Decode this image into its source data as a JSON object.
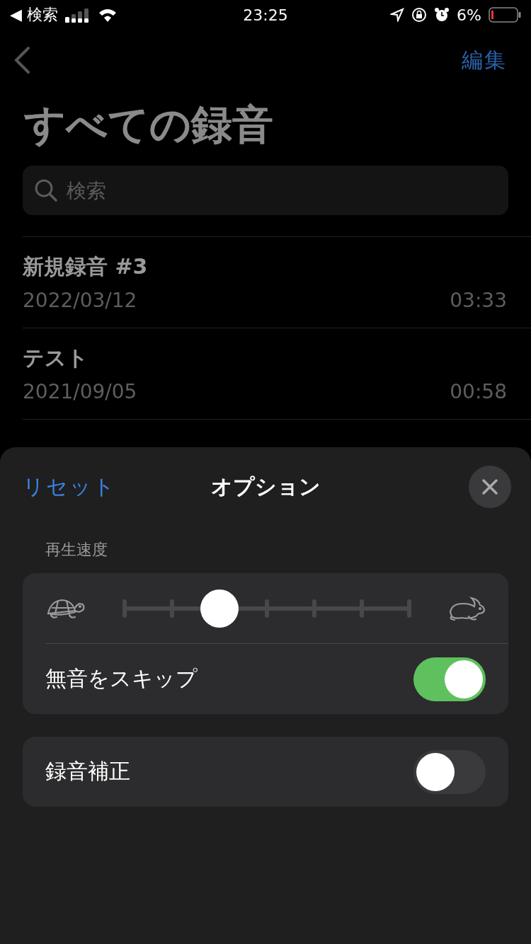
{
  "status_bar": {
    "back_label": "◀ 検索",
    "time": "23:25",
    "battery": "6%"
  },
  "nav": {
    "edit": "編集"
  },
  "title": "すべての録音",
  "search": {
    "placeholder": "検索"
  },
  "recordings": [
    {
      "name": "新規録音 #3",
      "date": "2022/03/12",
      "duration": "03:33"
    },
    {
      "name": "テスト",
      "date": "2021/09/05",
      "duration": "00:58"
    }
  ],
  "sheet": {
    "reset": "リセット",
    "title": "オプション",
    "speed": {
      "label": "再生速度",
      "level": 0.3333
    },
    "groups": [
      {
        "options": [
          {
            "kind": "toggle",
            "label": "無音をスキップ",
            "on": true
          }
        ]
      },
      {
        "options": [
          {
            "kind": "toggle",
            "label": "録音補正",
            "on": false
          }
        ]
      }
    ]
  }
}
